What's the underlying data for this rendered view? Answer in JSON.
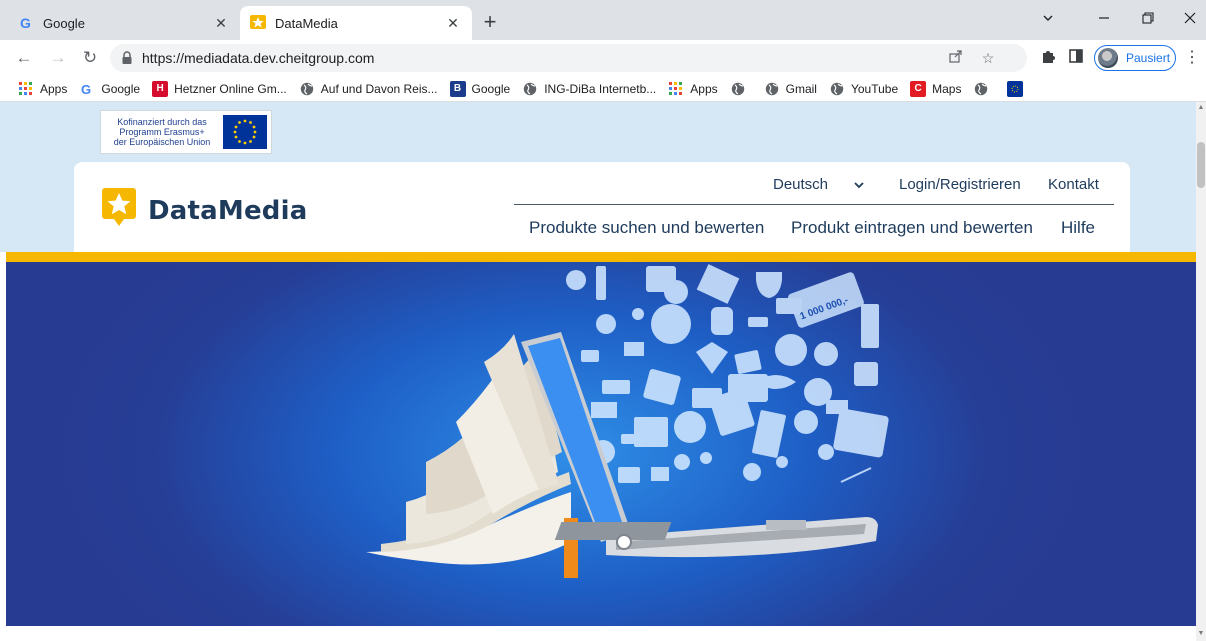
{
  "tabs": [
    {
      "title": "Google"
    },
    {
      "title": "DataMedia"
    }
  ],
  "toolbar": {
    "url": "https://mediadata.dev.cheitgroup.com",
    "profile_label": "Pausiert"
  },
  "bookmarks": [
    {
      "label": "Apps",
      "icon": "apps-grid-icon"
    },
    {
      "label": "Google",
      "icon": "google-g-icon"
    },
    {
      "label": "Hetzner Online Gm...",
      "icon": "hetzner-h-icon"
    },
    {
      "label": "Auf und Davon Reis...",
      "icon": "globe-icon"
    },
    {
      "label": "Google",
      "icon": "b-icon"
    },
    {
      "label": "ING-DiBa Internetb...",
      "icon": "globe-icon"
    },
    {
      "label": "Apps",
      "icon": "apps-grid-icon"
    },
    {
      "label": "",
      "icon": "globe-icon"
    },
    {
      "label": "Gmail",
      "icon": "globe-icon"
    },
    {
      "label": "YouTube",
      "icon": "globe-icon"
    },
    {
      "label": "Maps",
      "icon": "c-icon"
    },
    {
      "label": "",
      "icon": "globe-icon"
    },
    {
      "label": "",
      "icon": "eu-flag-icon"
    }
  ],
  "site": {
    "erasmus_text": [
      "Kofinanziert durch das",
      "Programm Erasmus+",
      "der Europäischen Union"
    ],
    "logo_text": "DataMedia",
    "language": "Deutsch",
    "login": "Login/Registrieren",
    "contact": "Kontakt",
    "nav": [
      {
        "label": "Produkte suchen und bewerten"
      },
      {
        "label": "Produkt eintragen und bewerten"
      },
      {
        "label": "Hilfe"
      }
    ],
    "hero_text": "1 000 000,-"
  },
  "colors": {
    "brand_navy": "#1e3b5c",
    "brand_yellow": "#f5b700",
    "hero_blue": "#1e5fc6",
    "header_bg": "#d6e8f5",
    "accent_blue": "#1a73e8"
  }
}
